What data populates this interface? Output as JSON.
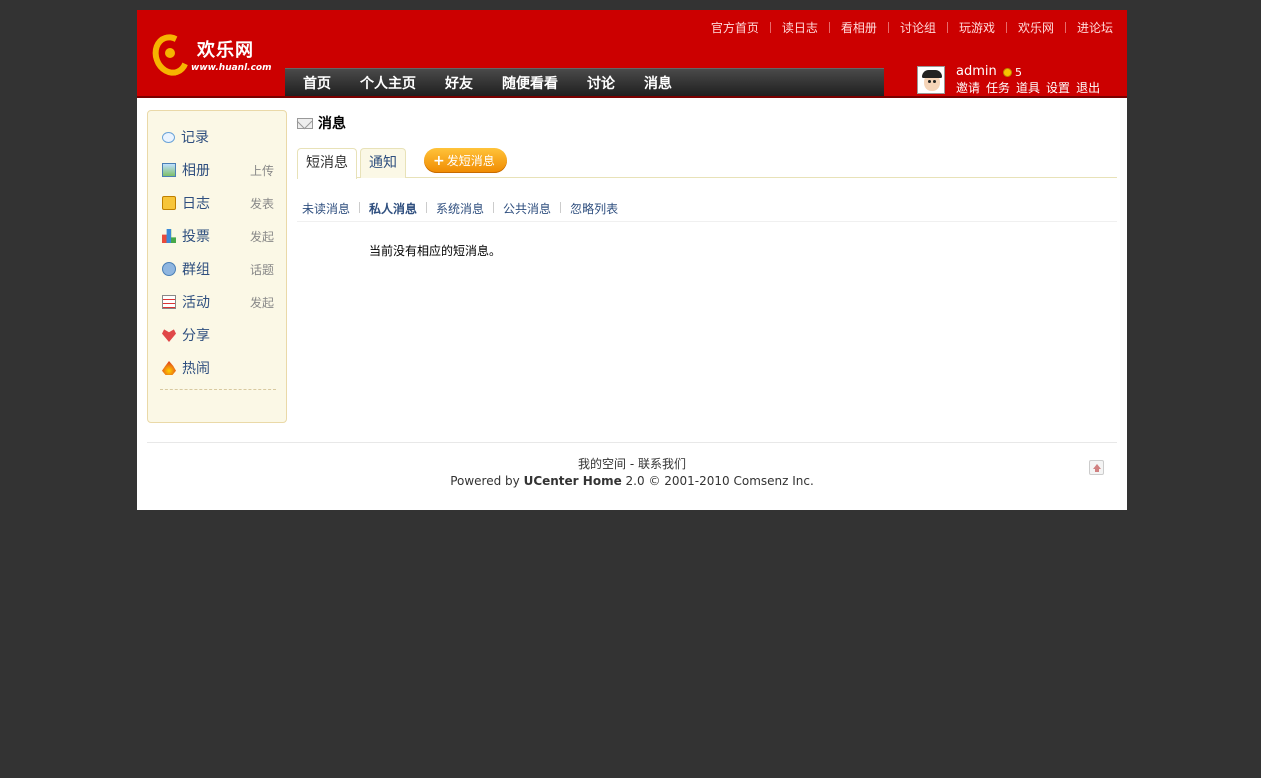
{
  "logo": {
    "name": "欢乐网",
    "url": "www.huanl.com"
  },
  "topnav": [
    "官方首页",
    "读日志",
    "看相册",
    "讨论组",
    "玩游戏",
    "欢乐网",
    "进论坛"
  ],
  "mainnav": [
    "首页",
    "个人主页",
    "好友",
    "随便看看",
    "讨论",
    "消息"
  ],
  "user": {
    "name": "admin",
    "credit": "5",
    "menu": [
      "邀请",
      "任务",
      "道具",
      "设置",
      "退出"
    ]
  },
  "sidebar": {
    "items": [
      {
        "label": "记录",
        "icon": "speech-bubble-icon",
        "action": ""
      },
      {
        "label": "相册",
        "icon": "photo-icon",
        "action": "上传"
      },
      {
        "label": "日志",
        "icon": "notepad-icon",
        "action": "发表"
      },
      {
        "label": "投票",
        "icon": "bar-chart-icon",
        "action": "发起"
      },
      {
        "label": "群组",
        "icon": "group-icon",
        "action": "话题"
      },
      {
        "label": "活动",
        "icon": "calendar-icon",
        "action": "发起"
      },
      {
        "label": "分享",
        "icon": "heart-icon",
        "action": ""
      },
      {
        "label": "热闹",
        "icon": "flame-icon",
        "action": ""
      }
    ]
  },
  "content": {
    "title": "消息",
    "tabs": [
      "短消息",
      "通知"
    ],
    "send_button": "发短消息",
    "subnav": [
      "未读消息",
      "私人消息",
      "系统消息",
      "公共消息",
      "忽略列表"
    ],
    "empty": "当前没有相应的短消息。"
  },
  "footer": {
    "link1": "我的空间",
    "sep": "-",
    "link2": "联系我们",
    "powered_prefix": "Powered by",
    "brand": "UCenter Home",
    "powered_suffix": "2.0 © 2001-2010 Comsenz Inc."
  }
}
